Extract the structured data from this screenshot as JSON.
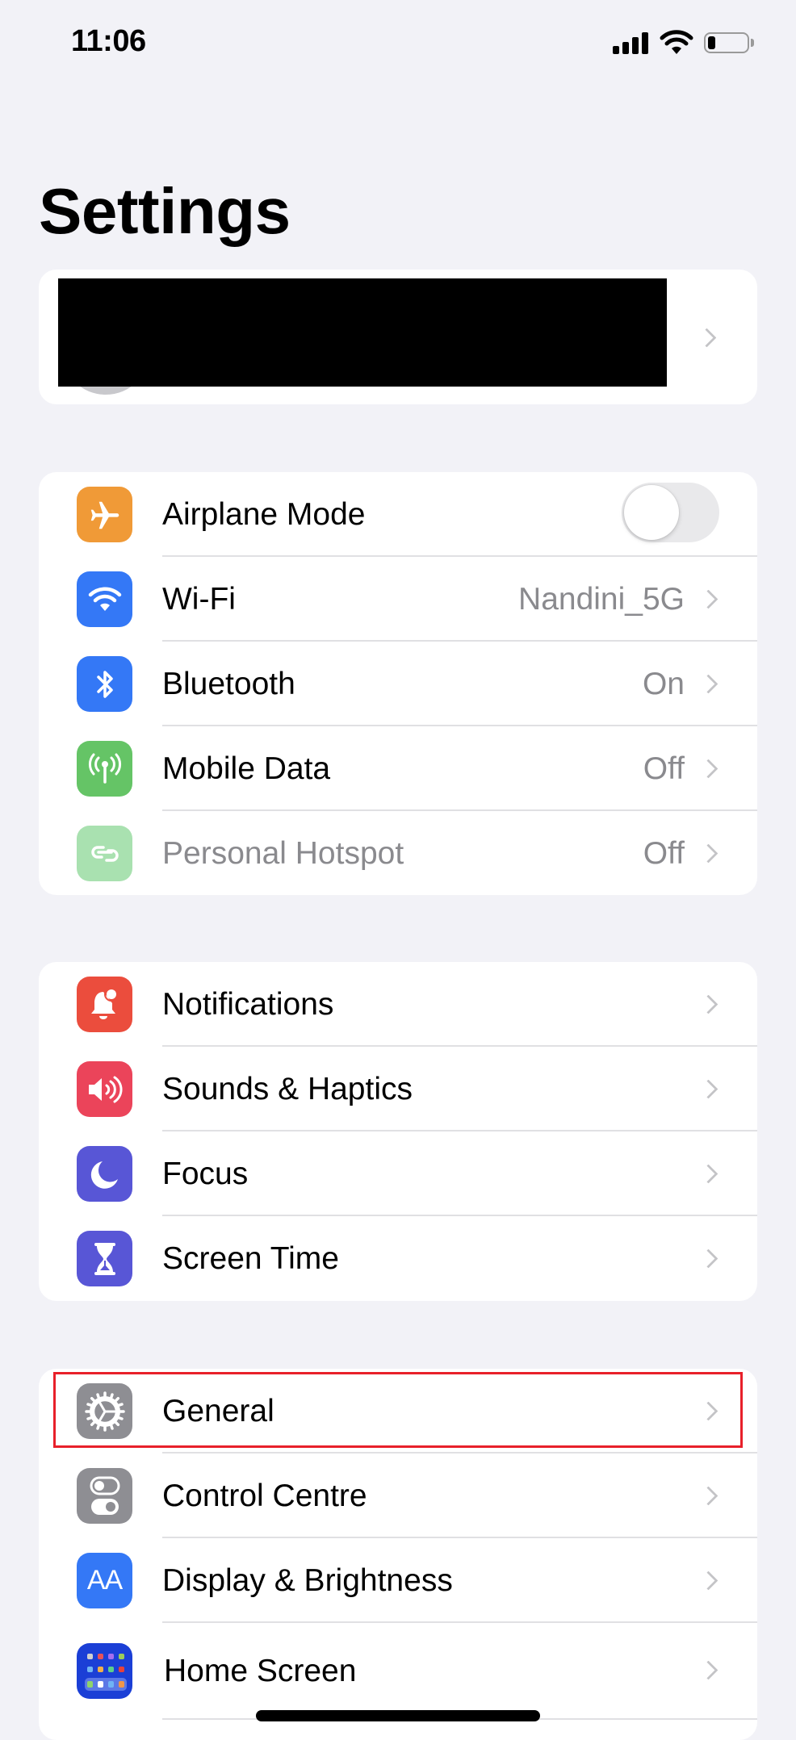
{
  "status_bar": {
    "time": "11:06",
    "signal_bars": 4,
    "wifi": "connected",
    "battery_percent": 20
  },
  "header": {
    "title": "Settings"
  },
  "profile": {
    "redacted": true
  },
  "groups": [
    {
      "items": [
        {
          "label": "Airplane Mode",
          "icon": "airplane-icon",
          "icon_color": "#f09a37",
          "control": "toggle",
          "toggle_on": false
        },
        {
          "label": "Wi-Fi",
          "icon": "wifi-icon",
          "icon_color": "#3478f6",
          "value": "Nandini_5G"
        },
        {
          "label": "Bluetooth",
          "icon": "bluetooth-icon",
          "icon_color": "#3478f6",
          "value": "On"
        },
        {
          "label": "Mobile Data",
          "icon": "antenna-icon",
          "icon_color": "#65c466",
          "value": "Off"
        },
        {
          "label": "Personal Hotspot",
          "icon": "hotspot-icon",
          "icon_color": "#a9e1b0",
          "value": "Off",
          "disabled": true
        }
      ]
    },
    {
      "items": [
        {
          "label": "Notifications",
          "icon": "bell-icon",
          "icon_color": "#eb4d3d"
        },
        {
          "label": "Sounds & Haptics",
          "icon": "speaker-icon",
          "icon_color": "#eb445a"
        },
        {
          "label": "Focus",
          "icon": "moon-icon",
          "icon_color": "#5856d6"
        },
        {
          "label": "Screen Time",
          "icon": "hourglass-icon",
          "icon_color": "#5856d6"
        }
      ]
    },
    {
      "items": [
        {
          "label": "General",
          "icon": "gear-icon",
          "icon_color": "#8e8e93",
          "highlighted": true
        },
        {
          "label": "Control Centre",
          "icon": "switches-icon",
          "icon_color": "#8e8e93"
        },
        {
          "label": "Display & Brightness",
          "icon": "text-size-icon",
          "icon_color": "#3478f6",
          "icon_text": "AA"
        },
        {
          "label": "Home Screen",
          "icon": "home-screen-icon",
          "icon_color": "#1b3fd6"
        }
      ]
    }
  ],
  "highlight_color": "#e8202a"
}
